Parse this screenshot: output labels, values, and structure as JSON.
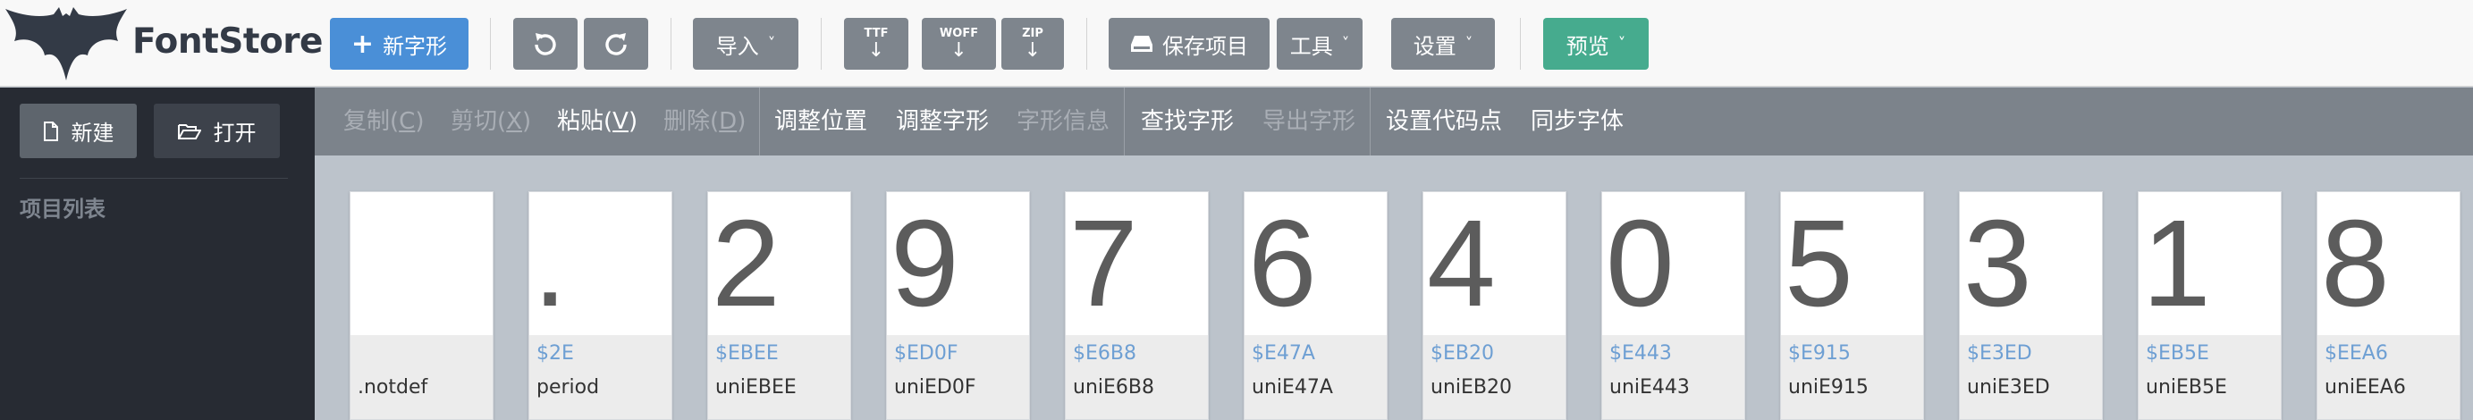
{
  "app": {
    "name": "FontStore"
  },
  "toolbar": {
    "new_glyph": "新字形",
    "import": "导入",
    "download_ttf": "TTF",
    "download_woff": "WOFF",
    "download_zip": "ZIP",
    "save_project": "保存项目",
    "tools": "工具",
    "settings": "设置",
    "preview": "预览"
  },
  "sidebar": {
    "new_label": "新建",
    "open_label": "打开",
    "project_list_title": "项目列表"
  },
  "editbar": {
    "copy": "复制",
    "copy_key": "C",
    "cut": "剪切",
    "cut_key": "X",
    "paste": "粘贴",
    "paste_key": "V",
    "delete": "删除",
    "delete_key": "D",
    "adjust_position": "调整位置",
    "adjust_glyph": "调整字形",
    "glyph_info": "字形信息",
    "find_glyph": "查找字形",
    "export_glyph": "导出字形",
    "set_codepoint": "设置代码点",
    "sync_font": "同步字体"
  },
  "glyphs": [
    {
      "char": "",
      "code": "",
      "name": ".notdef"
    },
    {
      "char": ".",
      "code": "$2E",
      "name": "period"
    },
    {
      "char": "2",
      "code": "$EBEE",
      "name": "uniEBEE"
    },
    {
      "char": "9",
      "code": "$ED0F",
      "name": "uniED0F"
    },
    {
      "char": "7",
      "code": "$E6B8",
      "name": "uniE6B8"
    },
    {
      "char": "6",
      "code": "$E47A",
      "name": "uniE47A"
    },
    {
      "char": "4",
      "code": "$EB20",
      "name": "uniEB20"
    },
    {
      "char": "0",
      "code": "$E443",
      "name": "uniE443"
    },
    {
      "char": "5",
      "code": "$E915",
      "name": "uniE915"
    },
    {
      "char": "3",
      "code": "$E3ED",
      "name": "uniE3ED"
    },
    {
      "char": "1",
      "code": "$EB5E",
      "name": "uniEB5E"
    },
    {
      "char": "8",
      "code": "$EEA6",
      "name": "uniEEA6"
    }
  ]
}
